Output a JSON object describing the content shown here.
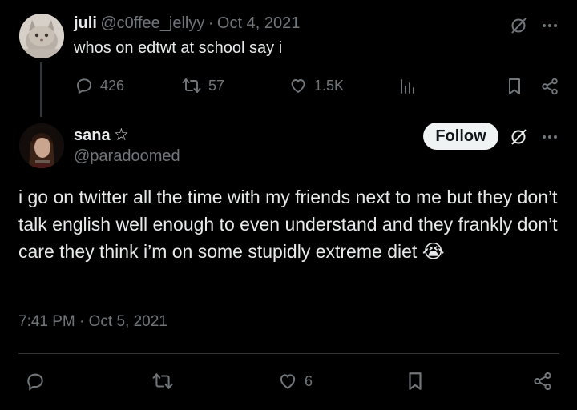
{
  "parent_tweet": {
    "display_name": "juli",
    "handle": "@c0ffee_jellyy",
    "separator": "·",
    "date": "Oct 4, 2021",
    "text": "whos on edtwt at school say i",
    "actions": {
      "replies": "426",
      "retweets": "57",
      "likes": "1.5K"
    }
  },
  "main_tweet": {
    "display_name": "sana",
    "name_symbol": "☆",
    "handle": "@paradoomed",
    "follow_label": "Follow",
    "text": "i go on twitter all the time with my friends next to me but they don’t talk english well enough to even understand and they frankly don’t care they think i’m on some stupidly extreme diet",
    "emoji": "😭",
    "timestamp": "7:41 PM · Oct 5, 2021",
    "actions": {
      "likes": "6"
    }
  },
  "icons": {
    "reply": "reply-icon",
    "retweet": "retweet-icon",
    "like": "heart-icon",
    "views": "views-icon",
    "bookmark": "bookmark-icon",
    "share": "share-icon",
    "grok": "grok-icon",
    "more": "more-icon"
  },
  "colors": {
    "background": "#000000",
    "text": "#e7e9ea",
    "muted": "#71767b",
    "divider": "#2f3336",
    "follow_bg": "#eff3f4"
  }
}
